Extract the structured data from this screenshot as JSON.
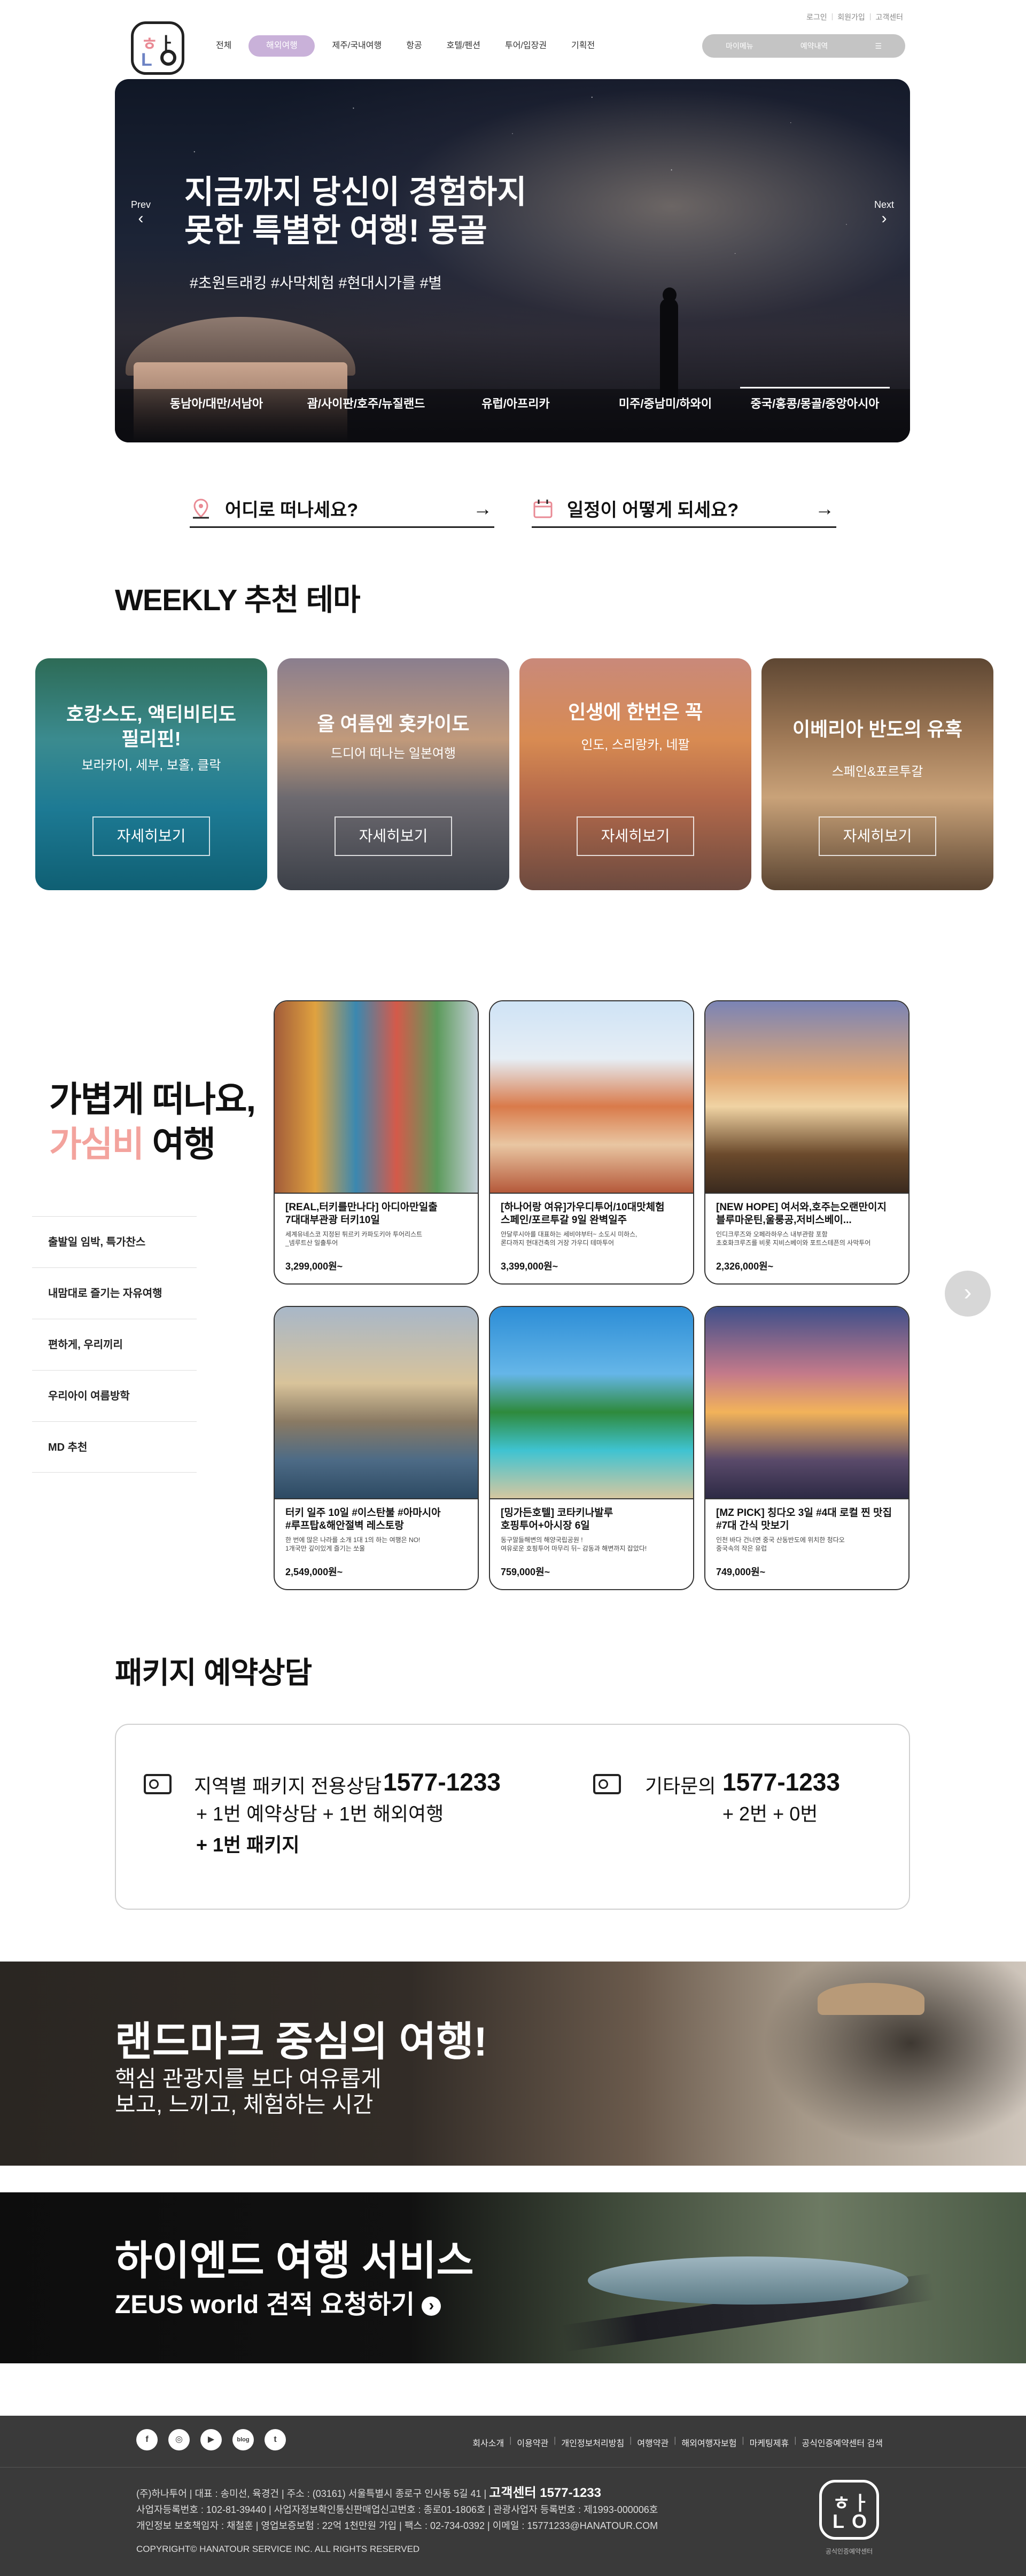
{
  "top_links": [
    "로그인",
    "회원가입",
    "고객센터"
  ],
  "logo_text": "하나투어",
  "gnb": [
    {
      "label": "전체",
      "active": false
    },
    {
      "label": "해외여행",
      "active": true
    },
    {
      "label": "제주/국내여행",
      "active": false
    },
    {
      "label": "항공",
      "active": false
    },
    {
      "label": "호텔/펜션",
      "active": false
    },
    {
      "label": "투어/입장권",
      "active": false
    },
    {
      "label": "기획전",
      "active": false
    }
  ],
  "util": [
    "마이메뉴",
    "예약내역",
    "☰"
  ],
  "hero": {
    "title": "지금까지 당신이 경험하지\n못한 특별한 여행! 몽골",
    "tags": "#초원트래킹 #사막체험 #현대시가를 #별",
    "prev": "Prev",
    "next": "Next",
    "tabs": [
      {
        "label": "동남아/대만/서남아",
        "active": false
      },
      {
        "label": "괌/사이판/호주/뉴질랜드",
        "active": false
      },
      {
        "label": "유럽/아프리카",
        "active": false
      },
      {
        "label": "미주/중남미/하와이",
        "active": false
      },
      {
        "label": "중국/홍콩/몽골/중앙아시아",
        "active": true
      }
    ]
  },
  "search": {
    "where": "어디로 떠나세요?",
    "when": "일정이 어떻게 되세요?"
  },
  "weekly": {
    "title": "WEEKLY 추천 테마",
    "cards": [
      {
        "title": "호캉스도, 액티비티도\n필리핀!",
        "sub": "보라카이, 세부, 보홀, 클락",
        "button": "자세히보기"
      },
      {
        "title": "올 여름엔 홋카이도",
        "sub": "드디어 떠나는 일본여행",
        "button": "자세히보기"
      },
      {
        "title": "인생에 한번은 꼭",
        "sub": "인도, 스리랑카, 네팔",
        "button": "자세히보기"
      },
      {
        "title": "이베리아 반도의 유혹",
        "sub": "스페인&포르투갈",
        "button": "자세히보기"
      }
    ]
  },
  "packages": {
    "title_line1": "가볍게 떠나요,",
    "title_accent": "가심비",
    "title_rest": " 여행",
    "menu": [
      "출발일 임박, 특가찬스",
      "내맘대로 즐기는 자유여행",
      "편하게, 우리끼리",
      "우리아이 여름방학",
      "MD 추천"
    ],
    "cards": [
      {
        "name": "[REAL,터키를만나다] 아디아만일출\n7대대부관광 터키10일",
        "desc": "세계유네스코 지정된 튀르키 카파도키아 투어리스트\n_넴루트산 일출투어",
        "price": "3,299,000원~"
      },
      {
        "name": "[하나어랑 여유]가우디투어/10대맛체험\n스페인/포르투갈 9일 완벽일주",
        "desc": "안달루시아를 대표하는 세비야부터~ 소도시 미하스,\n론다까지 현대건축의 거장 가우디 테마투어",
        "price": "3,399,000원~"
      },
      {
        "name": "[NEW HOPE] 여서와,호주는오랜만이지\n블루마운틴,울룽공,저비스베이...",
        "desc": "인디크루즈와 오페라하우스 내부관람 포함\n초호화크루즈를 비롯 지비스베이와 포트스테픈의 사막투어",
        "price": "2,326,000원~"
      },
      {
        "name": "터키 일주 10일 #이스탄불 #아마시아\n#루프탑&해안절벽 레스토랑",
        "desc": "한 번에 많은 나라를 소개 1대 1의 하는 여행은 NO!\n1개국만 깊이있게 즐기는 쏘울",
        "price": "2,549,000원~"
      },
      {
        "name": "[밍가든호텔] 코타키나발루\n호핑투어+아시장 6일",
        "desc": "동구말들해변의 해양국립공원 !\n여유로운 호핑투어 마무리 뒤~ 감동과 해변까지 잡았다!",
        "price": "759,000원~"
      },
      {
        "name": "[MZ PICK] 칭다오 3일 #4대 로컬 찐 맛집\n#7대 간식 맛보기",
        "desc": "인천 바다 건너면 중국 산동반도에 위치한 청다오\n중국속의 작은 유럽",
        "price": "749,000원~"
      }
    ],
    "next_arrow": "›"
  },
  "consult": {
    "title": "패키지 예약상담",
    "left_label": "지역별 패키지 전용상담",
    "left_number": "1577-1233",
    "left_sub1": "+ 1번 예약상담 + 1번 해외여행",
    "left_sub2": "+ 1번 패키지",
    "right_label": "기타문의",
    "right_number": "1577-1233",
    "right_sub": "+ 2번 + 0번"
  },
  "banner1": {
    "title": "랜드마크 중심의 여행!",
    "sub": "핵심 관광지를 보다 여유롭게\n보고, 느끼고, 체험하는 시간"
  },
  "banner2": {
    "title": "하이엔드 여행 서비스",
    "sub": "ZEUS world 견적 요청하기"
  },
  "footer": {
    "sns": [
      "f",
      "◎",
      "▶",
      "blog",
      "t"
    ],
    "links": [
      "회사소개",
      "이용약관",
      "개인정보처리방침",
      "여행약관",
      "해외여행자보험",
      "마케팅제휴",
      "공식인증예약센터 검색"
    ],
    "info_line1": "(주)하나투어 | 대표 : 송미선, 육경건 | 주소 : (03161) 서울특별시 종로구 인사동 5길 41 | ",
    "info_center": "고객센터 1577-1233",
    "info_line2": "사업자등록번호 : 102-81-39440 | 사업자정보확인통신판매업신고번호 : 종로01-1806호 | 관광사업자 등록번호 : 제1993-000006호",
    "info_line3": "개인정보 보호책임자 : 채철훈 | 영업보증보험 : 22억 1천만원 가입 | 팩스 : 02-734-0392 | 이메일 : 15771233@HANATOUR.COM",
    "copyright": "COPYRIGHT© HANATOUR SERVICE INC. ALL RIGHTS RESERVED",
    "logo_caption": "공식인증예약센터"
  },
  "colors": {
    "accent_purple": "#c9b1d9",
    "accent_pink": "#f3a39d",
    "footer_bg": "#3a3a3a"
  }
}
